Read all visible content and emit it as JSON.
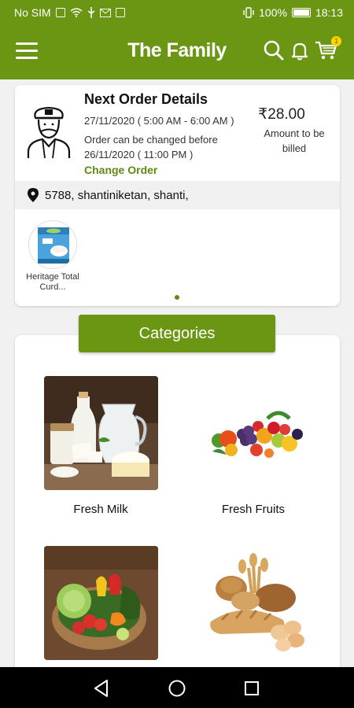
{
  "status_bar": {
    "carrier": "No SIM",
    "battery": "100%",
    "time": "18:13"
  },
  "header": {
    "title": "The Family",
    "cart_count": "1"
  },
  "order": {
    "title": "Next Order Details",
    "date_range": "27/11/2020 ( 5:00 AM - 6:00 AM )",
    "change_note": "Order can be changed before 26/11/2020 ( 11:00 PM )",
    "change_button": "Change Order",
    "amount": "₹28.00",
    "amount_label": "Amount to be billed",
    "address": "5788, shantiniketan, shanti,",
    "products": [
      {
        "name": "Heritage Total Curd..."
      }
    ]
  },
  "categories": {
    "heading": "Categories",
    "items": [
      {
        "label": "Fresh Milk"
      },
      {
        "label": "Fresh Fruits"
      },
      {
        "label": ""
      },
      {
        "label": ""
      }
    ]
  },
  "colors": {
    "brand": "#6a9613",
    "link": "#5f8a12"
  }
}
